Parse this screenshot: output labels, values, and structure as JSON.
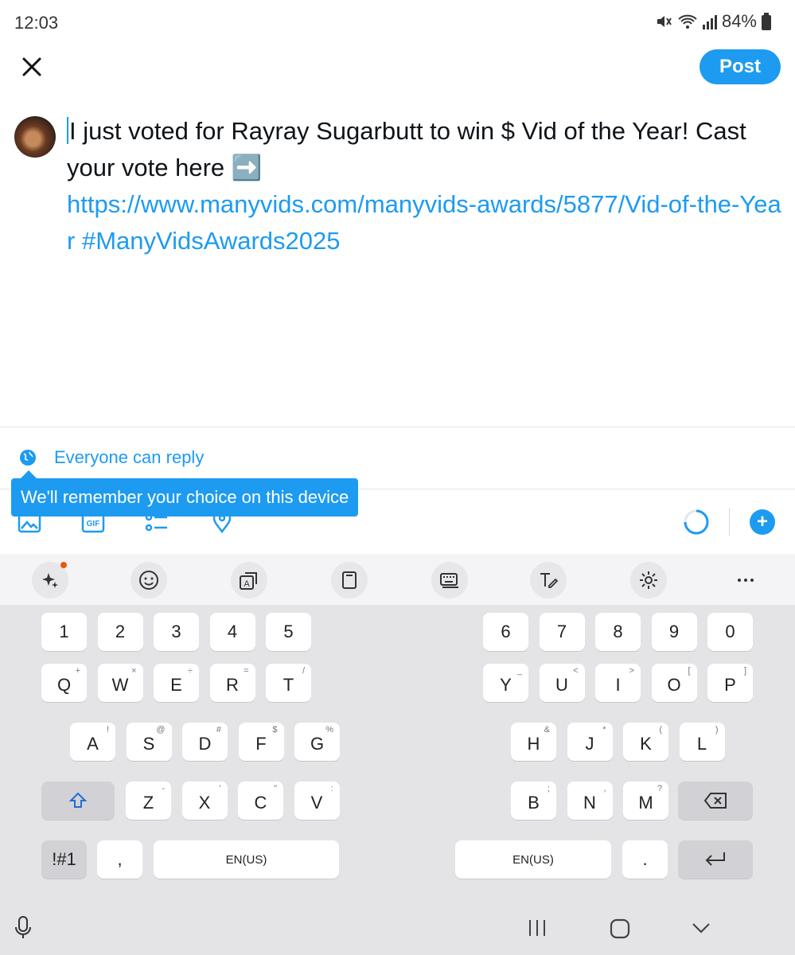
{
  "status_bar": {
    "time": "12:03",
    "battery": "84%"
  },
  "header": {
    "post_label": "Post"
  },
  "composer": {
    "text": "I just voted for Rayray Sugarbutt to win $ Vid of the Year! Cast your vote here ➡️",
    "link": "https://www.manyvids.com/manyvids-awards/5877/Vid-of-the-Year",
    "hashtag": "#ManyVidsAwards2025"
  },
  "reply_setting": {
    "label": "Everyone can reply"
  },
  "tooltip": {
    "text": "We'll remember your choice on this device"
  },
  "toolbar": {
    "add_label": "+"
  },
  "keyboard": {
    "left_rows": [
      [
        {
          "k": "1"
        },
        {
          "k": "2"
        },
        {
          "k": "3"
        },
        {
          "k": "4"
        },
        {
          "k": "5"
        }
      ],
      [
        {
          "k": "Q",
          "s": "+"
        },
        {
          "k": "W",
          "s": "×"
        },
        {
          "k": "E",
          "s": "÷"
        },
        {
          "k": "R",
          "s": "="
        },
        {
          "k": "T",
          "s": "/"
        }
      ],
      [
        {
          "k": "A",
          "s": "!"
        },
        {
          "k": "S",
          "s": "@"
        },
        {
          "k": "D",
          "s": "#"
        },
        {
          "k": "F",
          "s": "$"
        },
        {
          "k": "G",
          "s": "%"
        }
      ],
      [
        {
          "k": "Z",
          "s": "-"
        },
        {
          "k": "X",
          "s": "'"
        },
        {
          "k": "C",
          "s": "\""
        },
        {
          "k": "V",
          "s": ":"
        }
      ]
    ],
    "right_rows": [
      [
        {
          "k": "6"
        },
        {
          "k": "7"
        },
        {
          "k": "8"
        },
        {
          "k": "9"
        },
        {
          "k": "0"
        }
      ],
      [
        {
          "k": "Y",
          "s": "_"
        },
        {
          "k": "U",
          "s": "<"
        },
        {
          "k": "I",
          "s": ">"
        },
        {
          "k": "O",
          "s": "["
        },
        {
          "k": "P",
          "s": "]"
        }
      ],
      [
        {
          "k": "H",
          "s": "&"
        },
        {
          "k": "J",
          "s": "*"
        },
        {
          "k": "K",
          "s": "("
        },
        {
          "k": "L",
          "s": ")"
        }
      ],
      [
        {
          "k": "B",
          "s": ";"
        },
        {
          "k": "N",
          "s": ","
        },
        {
          "k": "M",
          "s": "?"
        }
      ]
    ],
    "symbols_key": "!#1",
    "comma_key": ",",
    "period_key": ".",
    "space_left": "EN(US)",
    "space_right": "EN(US)"
  }
}
